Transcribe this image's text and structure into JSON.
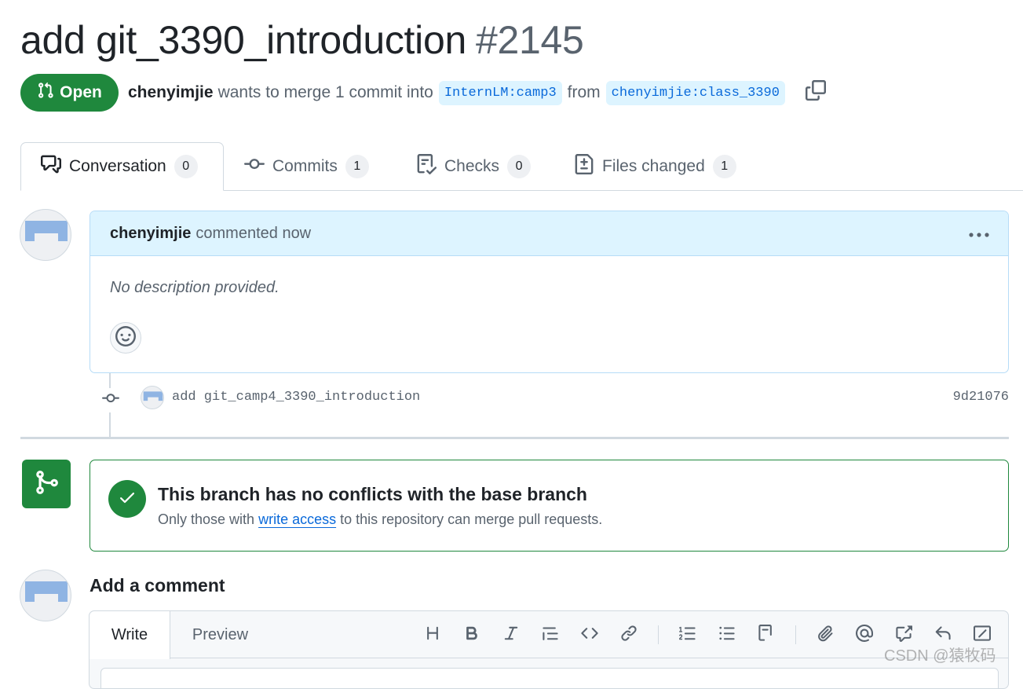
{
  "pr": {
    "title": "add git_3390_introduction",
    "number": "#2145",
    "state": "Open",
    "author": "chenyimjie",
    "merge_text": "wants to merge 1 commit into",
    "base_branch": "InternLM:camp3",
    "from_text": "from",
    "head_branch": "chenyimjie:class_3390"
  },
  "tabs": [
    {
      "label": "Conversation",
      "count": "0",
      "icon": "comment-discussion-icon"
    },
    {
      "label": "Commits",
      "count": "1",
      "icon": "git-commit-icon"
    },
    {
      "label": "Checks",
      "count": "0",
      "icon": "checklist-icon"
    },
    {
      "label": "Files changed",
      "count": "1",
      "icon": "file-diff-icon"
    }
  ],
  "comment": {
    "author": "chenyimjie",
    "action": "commented now",
    "body": "No description provided."
  },
  "commit": {
    "message": "add git_camp4_3390_introduction",
    "sha": "9d21076"
  },
  "merge_status": {
    "title": "This branch has no conflicts with the base branch",
    "prefix": "Only those with",
    "link": "write access",
    "suffix": "to this repository can merge pull requests."
  },
  "add_comment": {
    "title": "Add a comment",
    "write_tab": "Write",
    "preview_tab": "Preview"
  },
  "colors": {
    "open_green": "#1f883d",
    "link_blue": "#0969da",
    "header_blue": "#ddf4ff",
    "muted": "#59636e"
  },
  "watermark": "CSDN @猿牧码"
}
